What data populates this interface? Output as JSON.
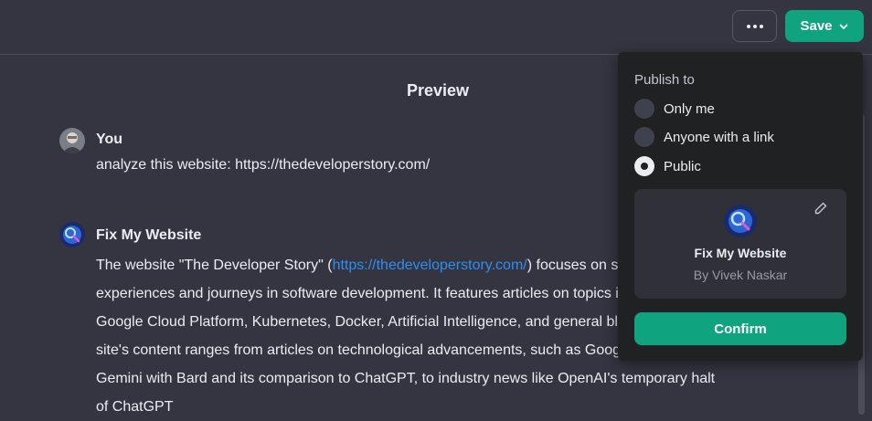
{
  "header": {
    "more_icon": "more-horizontal-icon",
    "save_label": "Save",
    "save_chevron_icon": "chevron-down-icon"
  },
  "preview": {
    "title": "Preview",
    "user_message": {
      "author": "You",
      "text": "analyze this website: https://thedeveloperstory.com/"
    },
    "gpt_message": {
      "author": "Fix My Website",
      "text_before_link": "The website \"The Developer Story\" (",
      "link": "https://thedeveloperstory.com/",
      "text_after_link": ") focuses on sharing experiences and journeys in software development. It features articles on topics including Java, Google Cloud Platform, Kubernetes, Docker, Artificial Intelligence, and general blog entries. The site's content ranges from articles on technological advancements, such as Google's release of Gemini with Bard and its comparison to ChatGPT, to industry news like OpenAI's temporary halt of ChatGPT"
    }
  },
  "publish": {
    "label": "Publish to",
    "options": [
      {
        "label": "Only me",
        "checked": false
      },
      {
        "label": "Anyone with a link",
        "checked": false
      },
      {
        "label": "Public",
        "checked": true
      }
    ],
    "card": {
      "name": "Fix My Website",
      "by": "By Vivek Naskar",
      "edit_icon": "pencil-icon"
    },
    "confirm_label": "Confirm"
  },
  "colors": {
    "background": "#343541",
    "panel": "#202123",
    "accent": "#10a37f",
    "link": "#2e8ef0"
  }
}
